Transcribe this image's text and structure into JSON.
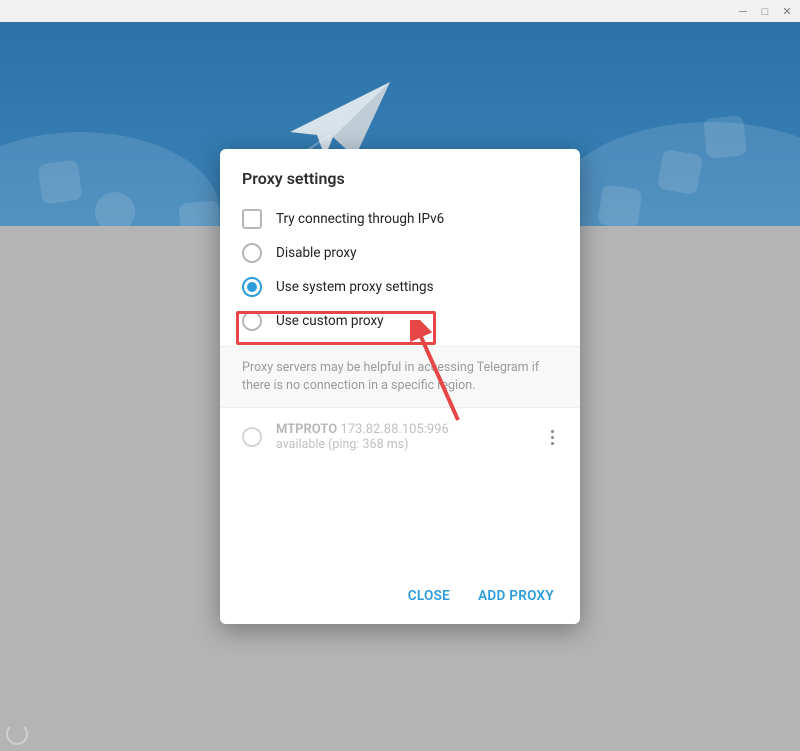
{
  "titlebar": {
    "minimize": "─",
    "maximize": "□",
    "close": "✕"
  },
  "dialog": {
    "title": "Proxy settings",
    "options": {
      "ipv6": "Try connecting through IPv6",
      "disable": "Disable proxy",
      "system": "Use system proxy settings",
      "custom": "Use custom proxy"
    },
    "selected": "system",
    "info": "Proxy servers may be helpful in accessing Telegram if there is no connection in a specific region.",
    "proxies": [
      {
        "protocol": "MTPROTO",
        "address": "173.82.88.105:996",
        "status": "available (ping: 368 ms)"
      }
    ],
    "buttons": {
      "close": "CLOSE",
      "add": "ADD PROXY"
    }
  },
  "annotation": {
    "highlight_target": "custom-proxy-option"
  }
}
